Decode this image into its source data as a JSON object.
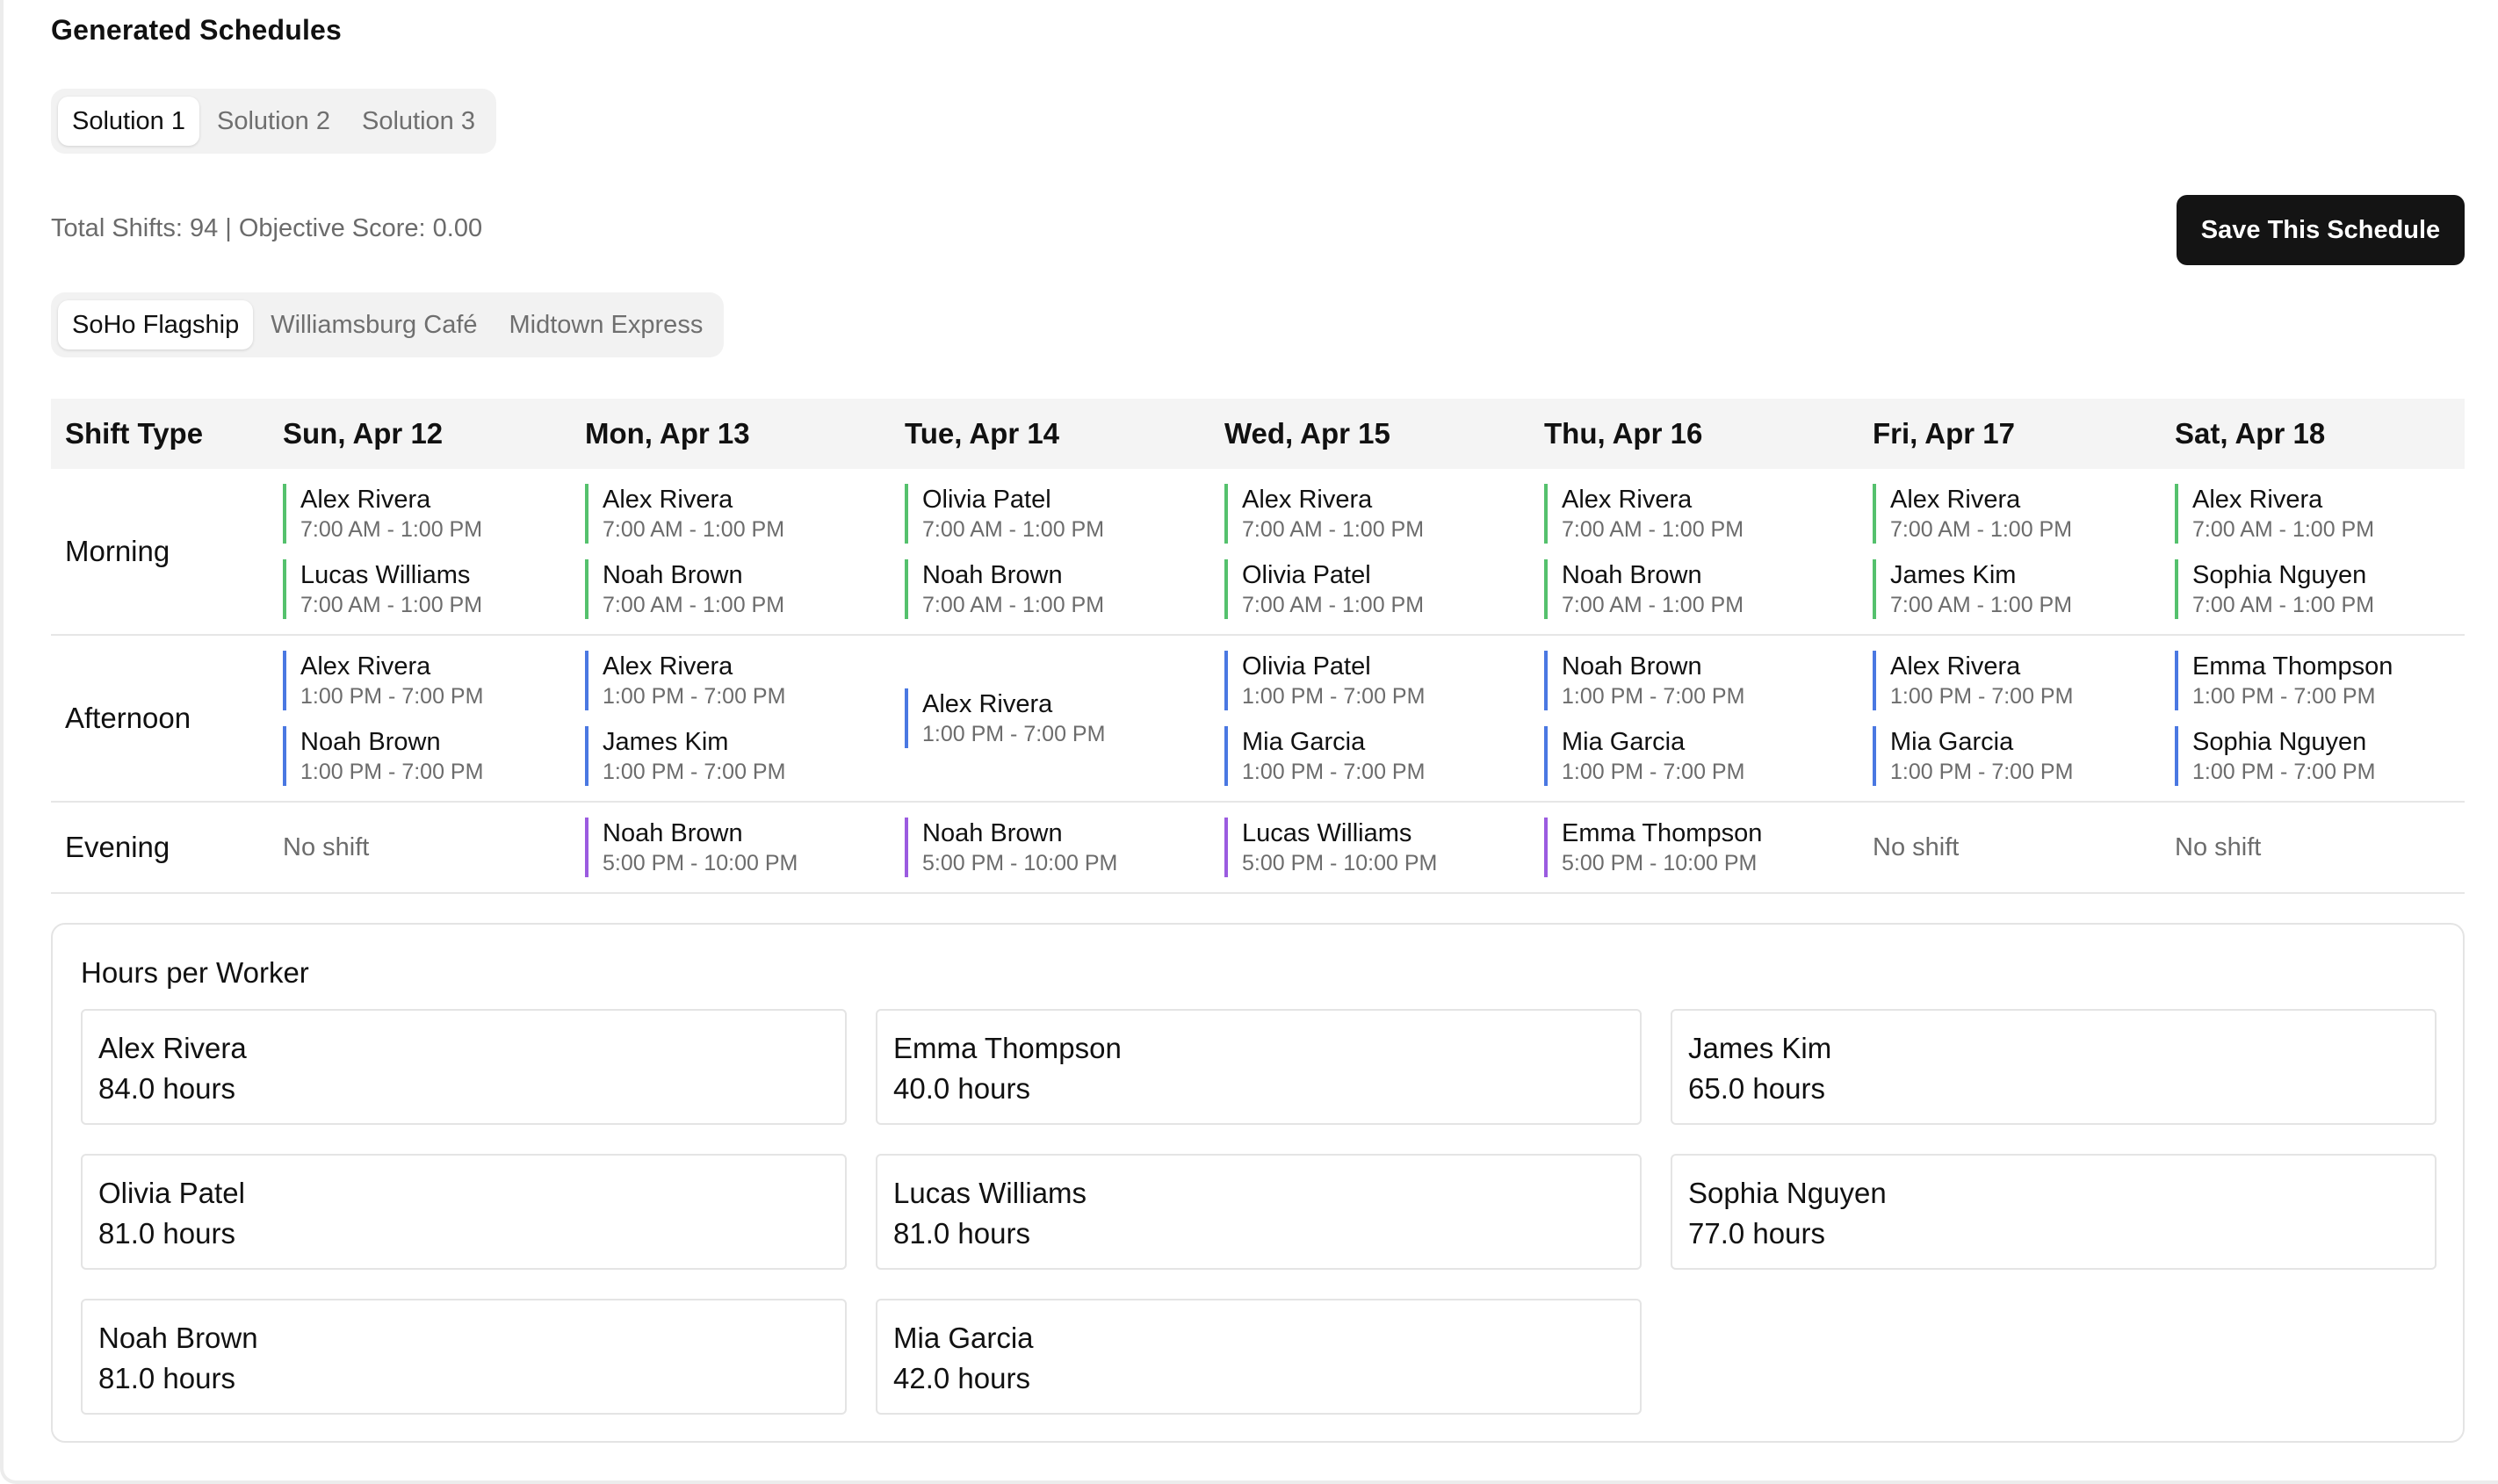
{
  "section_title": "Generated Schedules",
  "solution_tabs": [
    {
      "label": "Solution 1",
      "active": true
    },
    {
      "label": "Solution 2",
      "active": false
    },
    {
      "label": "Solution 3",
      "active": false
    }
  ],
  "stats_text": "Total Shifts: 94 | Objective Score: 0.00",
  "save_button": "Save This Schedule",
  "location_tabs": [
    {
      "label": "SoHo Flagship",
      "active": true
    },
    {
      "label": "Williamsburg Café",
      "active": false
    },
    {
      "label": "Midtown Express",
      "active": false
    }
  ],
  "schedule": {
    "row_header": "Shift Type",
    "days": [
      "Sun, Apr 12",
      "Mon, Apr 13",
      "Tue, Apr 14",
      "Wed, Apr 15",
      "Thu, Apr 16",
      "Fri, Apr 17",
      "Sat, Apr 18"
    ],
    "no_shift_label": "No shift",
    "rows": [
      {
        "label": "Morning",
        "kind": "morning",
        "cells": [
          [
            {
              "name": "Alex Rivera",
              "time": "7:00 AM - 1:00 PM"
            },
            {
              "name": "Lucas Williams",
              "time": "7:00 AM - 1:00 PM"
            }
          ],
          [
            {
              "name": "Alex Rivera",
              "time": "7:00 AM - 1:00 PM"
            },
            {
              "name": "Noah Brown",
              "time": "7:00 AM - 1:00 PM"
            }
          ],
          [
            {
              "name": "Olivia Patel",
              "time": "7:00 AM - 1:00 PM"
            },
            {
              "name": "Noah Brown",
              "time": "7:00 AM - 1:00 PM"
            }
          ],
          [
            {
              "name": "Alex Rivera",
              "time": "7:00 AM - 1:00 PM"
            },
            {
              "name": "Olivia Patel",
              "time": "7:00 AM - 1:00 PM"
            }
          ],
          [
            {
              "name": "Alex Rivera",
              "time": "7:00 AM - 1:00 PM"
            },
            {
              "name": "Noah Brown",
              "time": "7:00 AM - 1:00 PM"
            }
          ],
          [
            {
              "name": "Alex Rivera",
              "time": "7:00 AM - 1:00 PM"
            },
            {
              "name": "James Kim",
              "time": "7:00 AM - 1:00 PM"
            }
          ],
          [
            {
              "name": "Alex Rivera",
              "time": "7:00 AM - 1:00 PM"
            },
            {
              "name": "Sophia Nguyen",
              "time": "7:00 AM - 1:00 PM"
            }
          ]
        ]
      },
      {
        "label": "Afternoon",
        "kind": "afternoon",
        "cells": [
          [
            {
              "name": "Alex Rivera",
              "time": "1:00 PM - 7:00 PM"
            },
            {
              "name": "Noah Brown",
              "time": "1:00 PM - 7:00 PM"
            }
          ],
          [
            {
              "name": "Alex Rivera",
              "time": "1:00 PM - 7:00 PM"
            },
            {
              "name": "James Kim",
              "time": "1:00 PM - 7:00 PM"
            }
          ],
          [
            {
              "name": "Alex Rivera",
              "time": "1:00 PM - 7:00 PM"
            }
          ],
          [
            {
              "name": "Olivia Patel",
              "time": "1:00 PM - 7:00 PM"
            },
            {
              "name": "Mia Garcia",
              "time": "1:00 PM - 7:00 PM"
            }
          ],
          [
            {
              "name": "Noah Brown",
              "time": "1:00 PM - 7:00 PM"
            },
            {
              "name": "Mia Garcia",
              "time": "1:00 PM - 7:00 PM"
            }
          ],
          [
            {
              "name": "Alex Rivera",
              "time": "1:00 PM - 7:00 PM"
            },
            {
              "name": "Mia Garcia",
              "time": "1:00 PM - 7:00 PM"
            }
          ],
          [
            {
              "name": "Emma Thompson",
              "time": "1:00 PM - 7:00 PM"
            },
            {
              "name": "Sophia Nguyen",
              "time": "1:00 PM - 7:00 PM"
            }
          ]
        ]
      },
      {
        "label": "Evening",
        "kind": "evening",
        "cells": [
          [],
          [
            {
              "name": "Noah Brown",
              "time": "5:00 PM - 10:00 PM"
            }
          ],
          [
            {
              "name": "Noah Brown",
              "time": "5:00 PM - 10:00 PM"
            }
          ],
          [
            {
              "name": "Lucas Williams",
              "time": "5:00 PM - 10:00 PM"
            }
          ],
          [
            {
              "name": "Emma Thompson",
              "time": "5:00 PM - 10:00 PM"
            }
          ],
          [],
          []
        ]
      }
    ]
  },
  "shift_colors": {
    "morning": "#55c16d",
    "afternoon": "#4a78e2",
    "evening": "#9b5be0"
  },
  "hours_panel": {
    "title": "Hours per Worker",
    "workers": [
      {
        "name": "Alex Rivera",
        "hours": "84.0 hours"
      },
      {
        "name": "Emma Thompson",
        "hours": "40.0 hours"
      },
      {
        "name": "James Kim",
        "hours": "65.0 hours"
      },
      {
        "name": "Olivia Patel",
        "hours": "81.0 hours"
      },
      {
        "name": "Lucas Williams",
        "hours": "81.0 hours"
      },
      {
        "name": "Sophia Nguyen",
        "hours": "77.0 hours"
      },
      {
        "name": "Noah Brown",
        "hours": "81.0 hours"
      },
      {
        "name": "Mia Garcia",
        "hours": "42.0 hours"
      }
    ]
  }
}
